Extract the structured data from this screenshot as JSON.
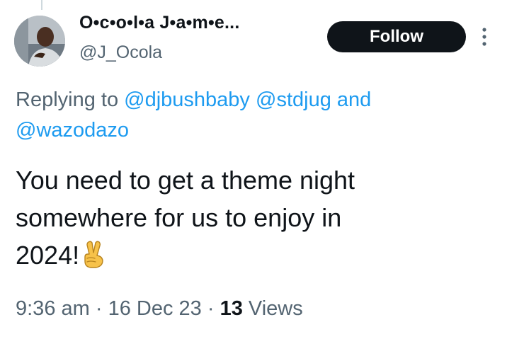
{
  "author": {
    "display_name": "O•c•o•l•a J•a•m•e...",
    "handle": "@J_Ocola"
  },
  "follow_label": "Follow",
  "reply": {
    "prefix": "Replying to",
    "mentions": [
      "@djbushbaby",
      "@stdjug",
      "@wazodazo"
    ],
    "conjunction": "and"
  },
  "tweet": {
    "lines": [
      "You need to get a theme night",
      "somewhere for us to enjoy in",
      "2024!"
    ],
    "emoji": "victory-hand-icon"
  },
  "meta": {
    "time": "9:36 am",
    "separator": "·",
    "date": "16 Dec 23",
    "views_count": "13",
    "views_label": "Views"
  },
  "colors": {
    "text": "#0f1419",
    "secondary": "#536471",
    "link": "#1d9bf0",
    "button_bg": "#0f1419",
    "button_text": "#ffffff"
  }
}
